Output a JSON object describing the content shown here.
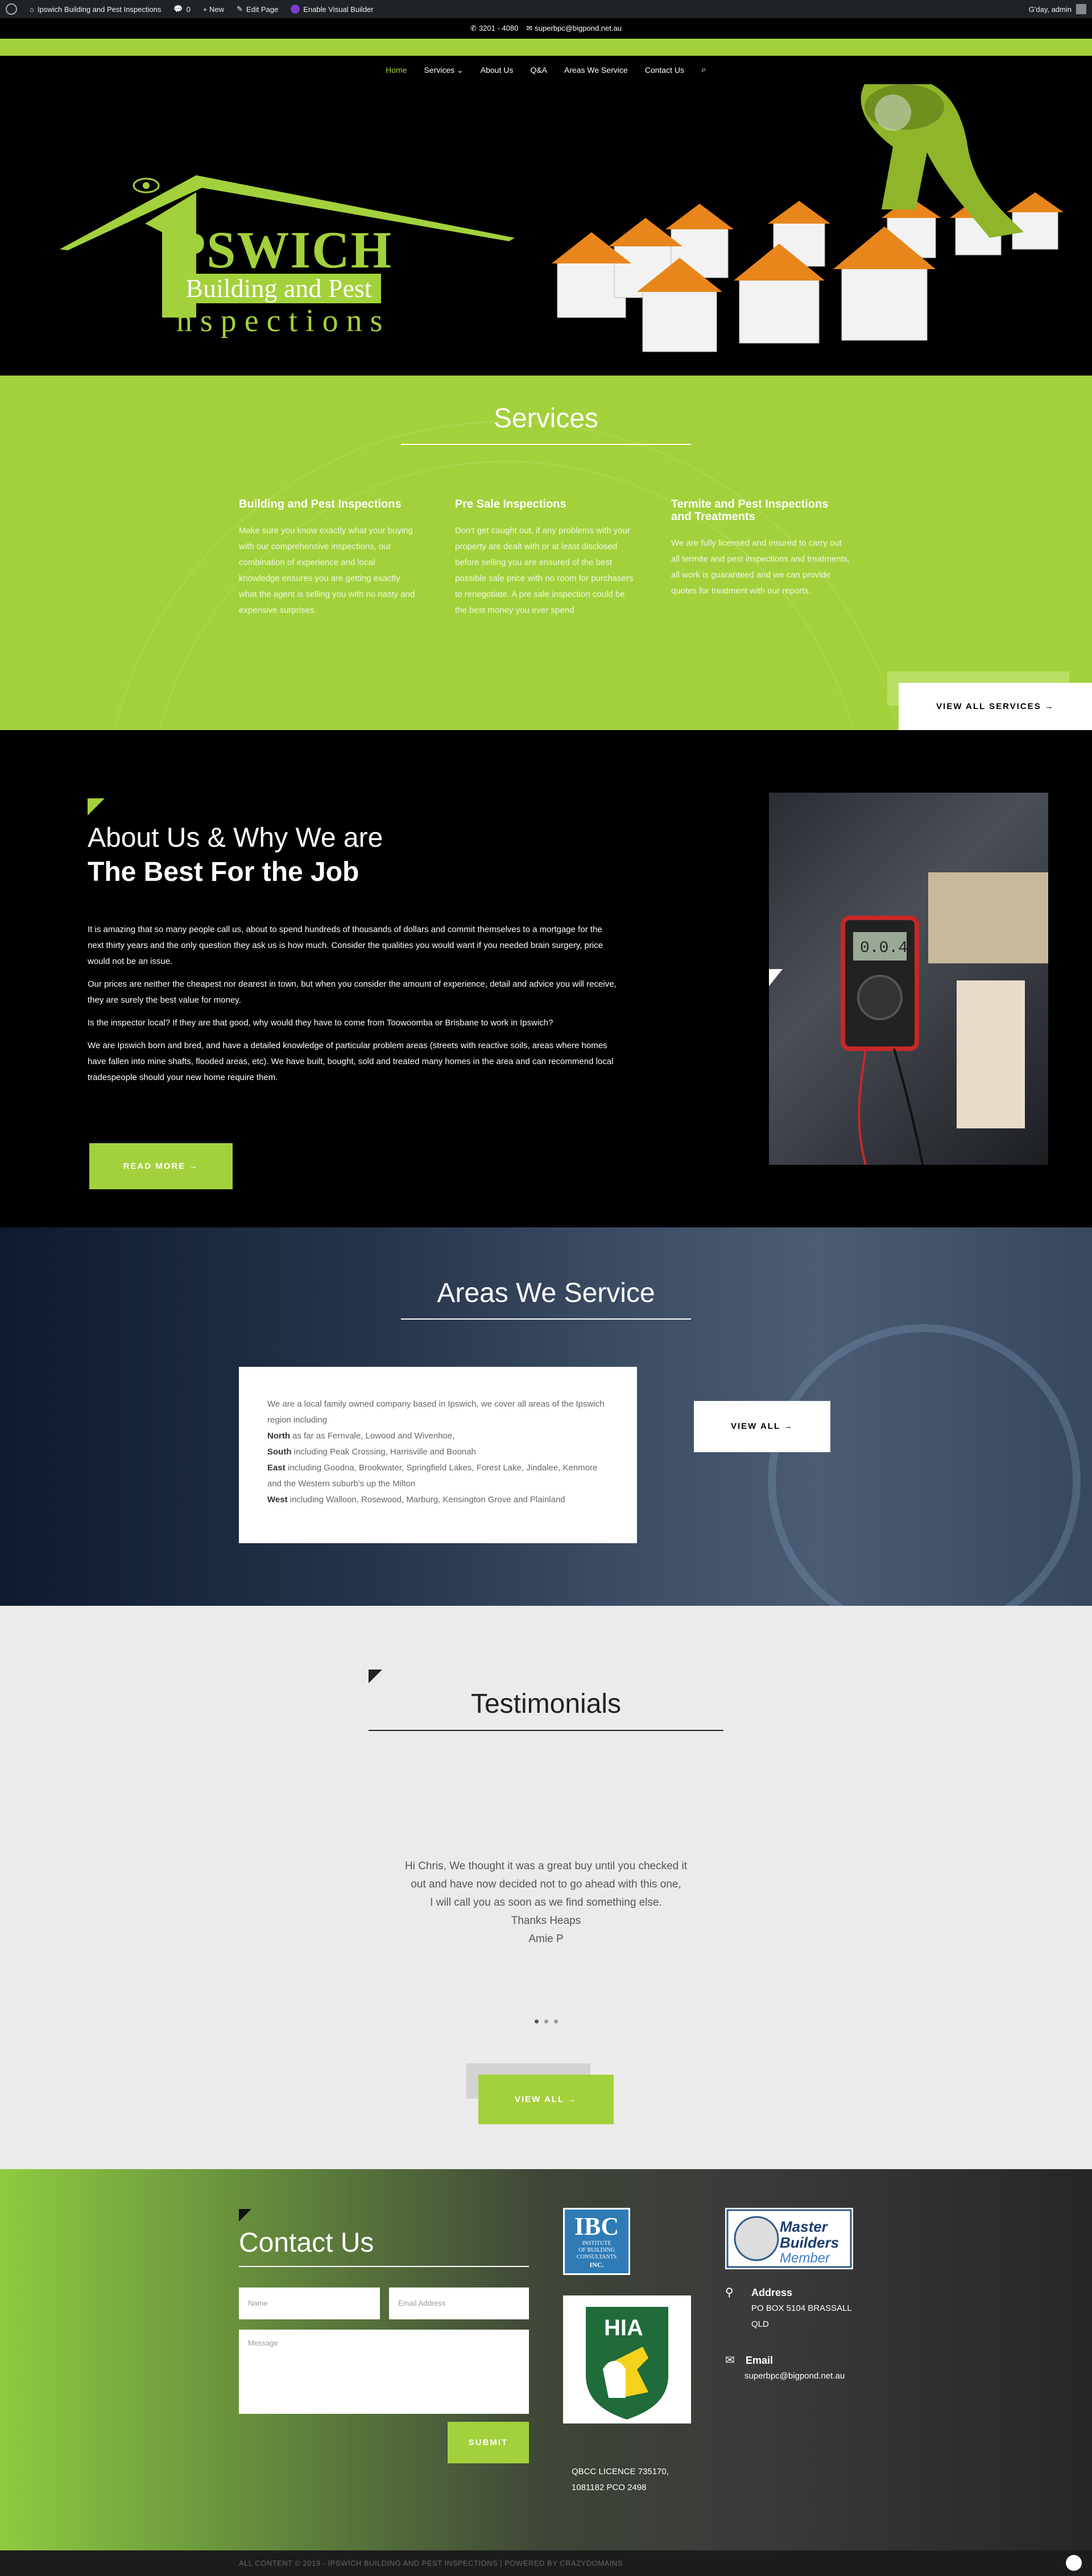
{
  "adminbar": {
    "site": "Ipswich Building and Pest Inspections",
    "comments": "0",
    "new": "+ New",
    "edit": "Edit Page",
    "visual": "Enable Visual Builder",
    "greeting": "G'day, admin"
  },
  "topbar": {
    "phone": "3201 - 4080",
    "email": "superbpc@bigpond.net.au"
  },
  "nav": [
    "Home",
    "Services",
    "About Us",
    "Q&A",
    "Areas We Service",
    "Contact Us"
  ],
  "logo": {
    "big": "PSWICH",
    "box_a": "Building and ",
    "box_b": "Pest",
    "sub": "nspections"
  },
  "services": {
    "title": "Services",
    "cols": [
      {
        "title": "Building and Pest Inspections",
        "text": "Make sure you know exactly what your buying with our comprehensive inspections, our combination of experience and local knowledge ensures you are getting exactly what the agent is selling you with no nasty and expensive surprises."
      },
      {
        "title": "Pre Sale Inspections",
        "text": "Don't get caught out, if any problems with your property are dealt with or at least disclosed before selling you are ensured of the best possible sale price with no room for purchasers to renegotiate. A pre sale inspection could be the best money you ever spend"
      },
      {
        "title": "Termite and Pest Inspections and Treatments",
        "text": "We are fully licensed and insured to carry out all termite and pest inspections and treatments, all work is guaranteed and we can provide quotes for treatment with our reports."
      }
    ],
    "button": "VIEW ALL SERVICES →"
  },
  "about": {
    "title_light": "About Us & Why We are",
    "title_bold": "The Best For the Job",
    "paras": [
      "It is amazing that so many people call us, about to spend hundreds of thousands of dollars and commit themselves to a mortgage for the next thirty years and the only question they ask us is how much. Consider the qualities you would want if you needed brain surgery, price would not be an issue.",
      "Our prices are neither the cheapest nor dearest in town, but when you consider the amount of experience, detail and advice you will receive, they are surely the best value for money.",
      "Is the inspector local? If they are that good, why would they have to come from Toowoomba or Brisbane to work in Ipswich?",
      "We are Ipswich born and bred, and have a detailed knowledge of particular problem areas (streets with reactive soils, areas where homes have fallen into mine shafts, flooded areas, etc). We have built, bought, sold and treated many homes in the area and can recommend local tradespeople should your new home require them."
    ],
    "button": "READ MORE →",
    "meter_reading": "0.0.4"
  },
  "areas": {
    "title": "Areas We Service",
    "intro": "We are a local family owned company based in Ipswich, we cover all areas of the Ipswich region including",
    "lines": [
      {
        "dir": "North",
        "text": " as far as Fernvale, Lowood and Wivenhoe,"
      },
      {
        "dir": "South",
        "text": " including Peak Crossing, Harrisville and Boonah"
      },
      {
        "dir": "East",
        "text": " including Goodna, Brookwater, Springfield Lakes, Forest Lake, Jindalee, Kenmore and the Western suburb's up the Milton"
      },
      {
        "dir": "West",
        "text": " including Walloon, Rosewood, Marburg, Kensington Grove and Plainland"
      }
    ],
    "button": "VIEW ALL →"
  },
  "testimonials": {
    "title": "Testimonials",
    "quote": [
      "Hi Chris, We thought it was a great buy until you checked it",
      "out and have now decided not to go ahead with this one,",
      "I will call you as soon as we find something else.",
      "Thanks Heaps",
      "Amie P"
    ],
    "button": "VIEW ALL →"
  },
  "contact": {
    "title": "Contact Us",
    "name_ph": "Name",
    "email_ph": "Email Address",
    "message_ph": "Message",
    "submit": "SUBMIT",
    "licence": [
      "QBCC LICENCE 735170,",
      "1081182 PCO 2498"
    ],
    "address_label": "Address",
    "address": [
      "PO BOX 5104 BRASSALL",
      "QLD"
    ],
    "email_label": "Email",
    "email": "superbpc@bigpond.net.au",
    "ibc": {
      "abbr": "IBC",
      "lines": [
        "INSTITUTE",
        "OF BUILDING",
        "CONSULTANTS"
      ],
      "mark": "INC."
    },
    "mbm": [
      "Master",
      "Builders",
      "Member"
    ],
    "hia": "HIA"
  },
  "footer": "ALL CONTENT © 2019 - IPSWICH BUILDING AND PEST INSPECTIONS | POWERED BY CRAZYDOMAINS",
  "colors": {
    "accent": "#a3d13c",
    "dark": "#000000"
  }
}
